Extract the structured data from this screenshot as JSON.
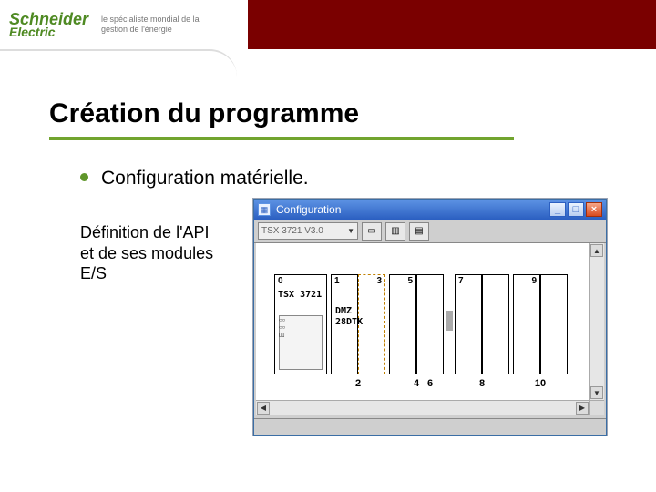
{
  "brand": {
    "name": "Schneider",
    "sub": "Electric",
    "tagline": "le spécialiste mondial de la gestion de l'énergie"
  },
  "slide": {
    "title": "Création du programme",
    "bullet": "Configuration matérielle.",
    "subtext": "Définition de l'API et de ses modules E/S"
  },
  "win": {
    "title": "Configuration",
    "combo": "TSX 3721 V3.0",
    "btn_min": "_",
    "btn_max": "□",
    "btn_close": "×"
  },
  "rack": {
    "slot0_num": "0",
    "slot0_label": "TSX 3721",
    "top_nums": [
      "1",
      "3",
      "5",
      "7",
      "9"
    ],
    "bottom_nums": [
      "2",
      "4",
      "6",
      "8",
      "10"
    ],
    "mod_labels": [
      "DMZ",
      "28DTK"
    ]
  }
}
